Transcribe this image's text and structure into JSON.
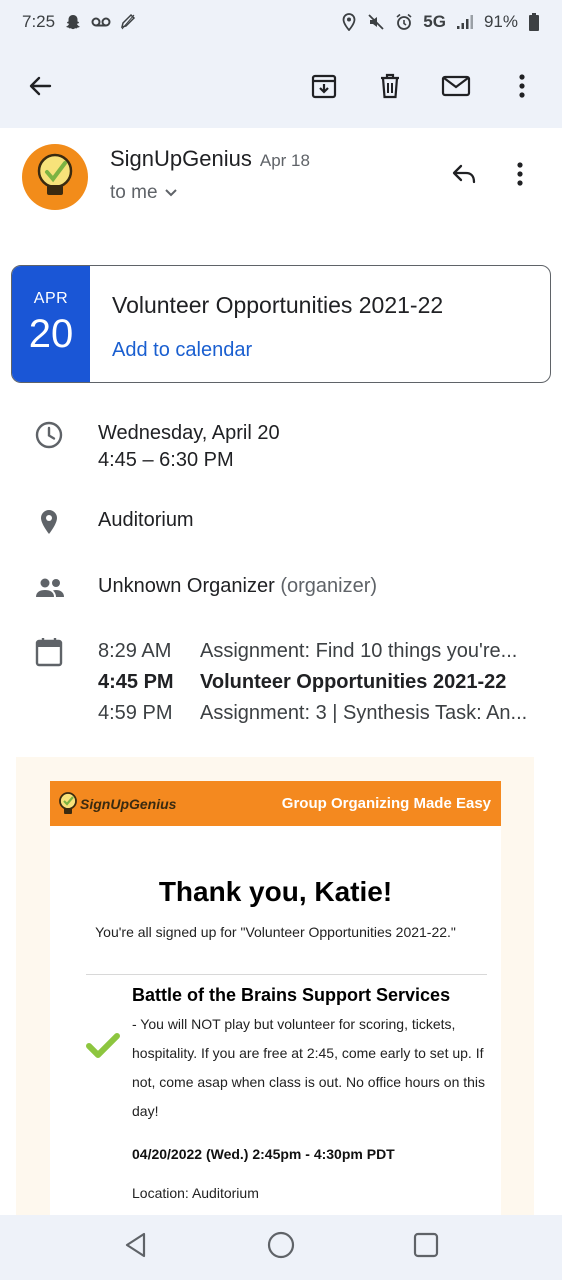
{
  "status_bar": {
    "time": "7:25",
    "network": "5G",
    "battery": "91%"
  },
  "app_bar": {
    "icons": [
      "back-arrow-icon",
      "archive-icon",
      "delete-icon",
      "mark-unread-icon",
      "more-vert-icon"
    ]
  },
  "message": {
    "sender": "SignUpGenius",
    "date": "Apr 18",
    "recipient": "to me"
  },
  "event_card": {
    "month": "APR",
    "day": "20",
    "title": "Volunteer Opportunities 2021-22",
    "add_to_calendar": "Add to calendar"
  },
  "details": {
    "date": "Wednesday, April 20",
    "time": "4:45 – 6:30 PM",
    "location": "Auditorium",
    "organizer_name": "Unknown Organizer",
    "organizer_role": "(organizer)"
  },
  "agenda": [
    {
      "time": "8:29 AM",
      "title": "Assignment: Find 10 things you're..."
    },
    {
      "time": "4:45 PM",
      "title": "Volunteer Opportunities 2021-22"
    },
    {
      "time": "4:59 PM",
      "title": "Assignment: 3 | Synthesis Task: An..."
    }
  ],
  "email": {
    "logo_text": "SignUpGenius",
    "tagline": "Group Organizing Made Easy",
    "heading": "Thank you, Katie!",
    "subheading": "You're all signed up for \"Volunteer Opportunities 2021-22.\"",
    "slot_title": "Battle of the Brains Support Services",
    "slot_description": "- You will NOT play but volunteer for scoring, tickets, hospitality. If you are free at 2:45, come early to set up. If not, come asap when class is out. No office hours on this day!",
    "slot_datetime": "04/20/2022 (Wed.) 2:45pm - 4:30pm PDT",
    "slot_location": "Location: Auditorium"
  },
  "colors": {
    "accent_blue": "#1a56d6",
    "brand_orange": "#f4891f",
    "check_green": "#8dc63f",
    "surface": "#eef2f9"
  }
}
